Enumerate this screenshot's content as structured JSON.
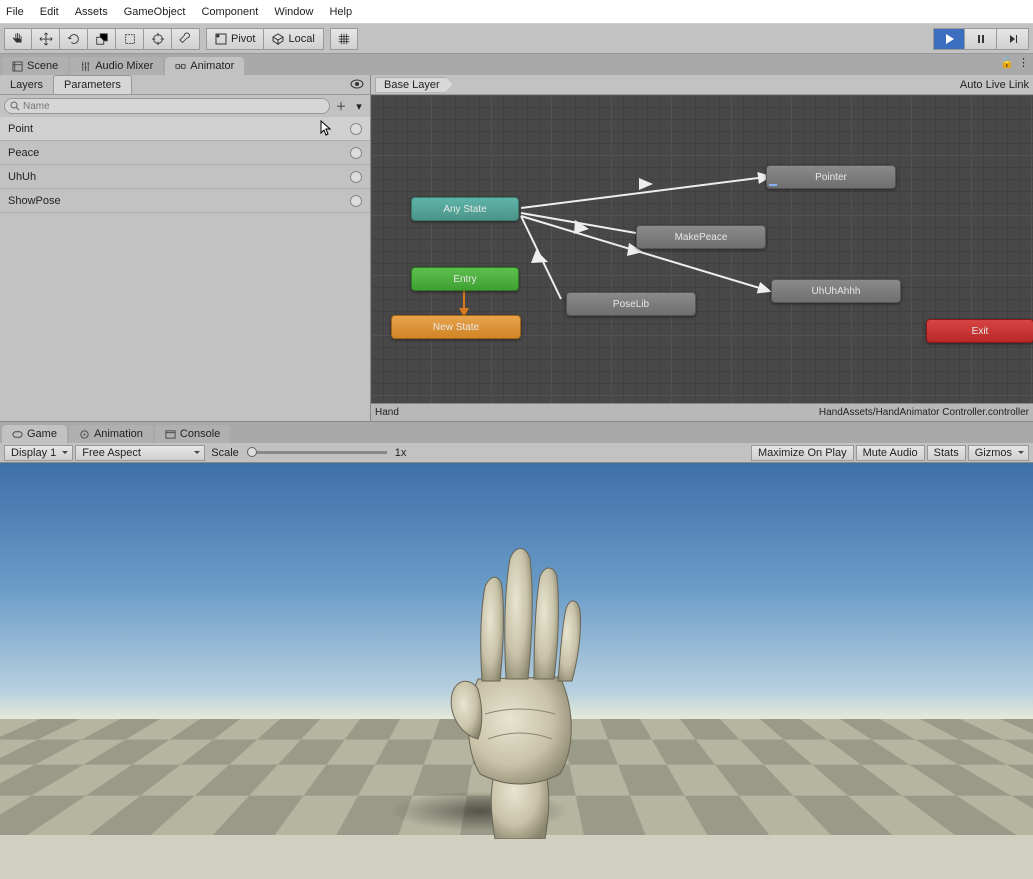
{
  "menu": {
    "items": [
      "File",
      "Edit",
      "Assets",
      "GameObject",
      "Component",
      "Window",
      "Help"
    ]
  },
  "toolbar": {
    "pivot": "Pivot",
    "local": "Local"
  },
  "upper_tabs": {
    "scene": "Scene",
    "audio": "Audio Mixer",
    "animator": "Animator"
  },
  "left_panel": {
    "tabs": {
      "layers": "Layers",
      "parameters": "Parameters"
    },
    "search_placeholder": "Name",
    "params": [
      {
        "name": "Point",
        "selected": true
      },
      {
        "name": "Peace",
        "selected": false
      },
      {
        "name": "UhUh",
        "selected": false
      },
      {
        "name": "ShowPose",
        "selected": false
      }
    ]
  },
  "graph": {
    "breadcrumb": "Base Layer",
    "auto_live_link": "Auto Live Link",
    "nodes": {
      "any_state": "Any State",
      "entry": "Entry",
      "new_state": "New State",
      "pointer": "Pointer",
      "make_peace": "MakePeace",
      "pose_lib": "PoseLib",
      "uhuhahhh": "UhUhAhhh",
      "exit": "Exit"
    },
    "footer_left": "Hand",
    "footer_right": "HandAssets/HandAnimator Controller.controller"
  },
  "lower_tabs": {
    "game": "Game",
    "animation": "Animation",
    "console": "Console"
  },
  "game_toolbar": {
    "display": "Display 1",
    "aspect": "Free Aspect",
    "scale_label": "Scale",
    "scale_value": "1x",
    "maximize": "Maximize On Play",
    "mute": "Mute Audio",
    "stats": "Stats",
    "gizmos": "Gizmos"
  }
}
